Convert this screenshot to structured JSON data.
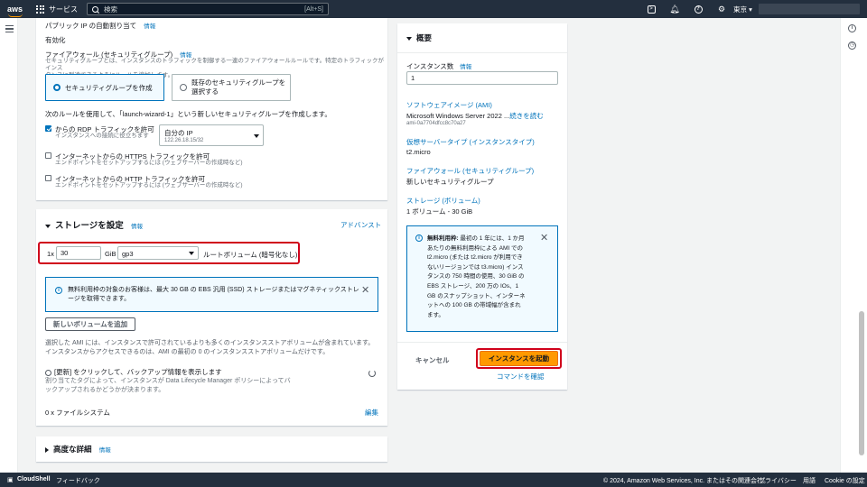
{
  "topnav": {
    "logo": "aws",
    "services": "サービス",
    "search_placeholder": "検索",
    "search_shortcut": "[Alt+S]",
    "region": "東京 ▾",
    "icons": [
      "cloudshell-icon",
      "bell-icon",
      "help-icon",
      "gear-icon"
    ]
  },
  "network": {
    "public_ip_label": "パブリック IP の自動割り当て",
    "public_ip_info": "情報",
    "public_ip_value": "有効化",
    "firewall_label": "ファイアウォール (セキュリティグループ)",
    "firewall_info": "情報",
    "firewall_desc_1": "セキュリティグループとは、インスタンスのトラフィックを制御する一連のファイアウォールルールです。特定のトラフィックがインス",
    "firewall_desc_2": "タンスに到達できるようにルールを追加します。",
    "option_create": "セキュリティグループを作成",
    "option_existing_1": "既存のセキュリティグループを",
    "option_existing_2": "選択する",
    "rule_note": "次のルールを使用して、「launch-wizard-1」という新しいセキュリティグループを作成します。",
    "ssh_label": "からの RDP トラフィックを許可",
    "ssh_sub": "インスタンスへの接続に役立ちます",
    "source_value": "自分の IP",
    "source_ip": "122.26.18.15/32",
    "https_label": "インターネットからの HTTPS トラフィックを許可",
    "https_sub": "エンドポイントをセットアップするには (ウェブサーバーの作成時など)",
    "http_label": "インターネットからの HTTP トラフィックを許可",
    "http_sub": "エンドポイントをセットアップするには (ウェブサーバーの作成時など)"
  },
  "storage": {
    "title": "ストレージを設定",
    "info": "情報",
    "advanced": "アドバンスト",
    "count_prefix": "1x",
    "size_value": "30",
    "size_unit": "GiB",
    "volume_type": "gp3",
    "root_label": "ルートボリューム  (暗号化なし)",
    "free_tier_msg_1": "無料利用枠の対象のお客様は、最大 30 GB の EBS 汎用 (SSD) ストレージまたはマグネティックストレ",
    "free_tier_msg_2": "ージを取得できます。",
    "add_volume": "新しいボリュームを追加",
    "ami_note_1": "選択した AMI には、インスタンスで許可されているよりも多くのインスタンスストアボリュームが含まれています。",
    "ami_note_2": "インスタンスからアクセスできるのは、AMI の最初の 0 のインスタンスストアボリュームだけです。",
    "backup_title": "[更新] をクリックして、バックアップ情報を表示します",
    "backup_desc_1": "割り当てたタグによって、インスタンスが Data Lifecycle Manager ポリシーによってバ",
    "backup_desc_2": "ックアップされるかどうかが決まります。",
    "filesystems": "0 x ファイルシステム",
    "edit": "編集"
  },
  "advanced_details": {
    "title": "高度な詳細",
    "info": "情報"
  },
  "summary": {
    "title": "概要",
    "instance_count_label": "インスタンス数",
    "instance_count_info": "情報",
    "instance_count_value": "1",
    "ami_label": "ソフトウェアイメージ (AMI)",
    "ami_value": "Microsoft Windows Server 2022 ...",
    "ami_more": "続きを読む",
    "ami_id": "ami-0a7704dfcc8c70a27",
    "instance_type_label": "仮想サーバータイプ (インスタンスタイプ)",
    "instance_type_value": "t2.micro",
    "firewall_label": "ファイアウォール (セキュリティグループ)",
    "firewall_value": "新しいセキュリティグループ",
    "storage_label": "ストレージ (ボリューム)",
    "storage_value": "1 ボリューム - 30 GiB",
    "free_tier_lines": [
      "無料利用枠: 最初の 1 年には、1 か月",
      "あたりの無料利用枠による AMI での",
      "t2.micro (または t2.micro が利用でき",
      "ないリージョンでは t3.micro) インス",
      "タンスの 750 時間の使用、30 GiB の",
      "EBS ストレージ、200 万の IOs、1",
      "GB のスナップショット、インターネ",
      "ットへの 100 GB の帯域幅が含まれ",
      "ます。"
    ],
    "cancel": "キャンセル",
    "launch": "インスタンスを起動",
    "preview_command": "コマンドを確認"
  },
  "footer": {
    "cloudshell": "CloudShell",
    "feedback": "フィードバック",
    "copyright": "© 2024, Amazon Web Services, Inc. またはその関連会社。",
    "privacy": "プライバシー",
    "terms": "用語",
    "cookie": "Cookie の設定"
  }
}
